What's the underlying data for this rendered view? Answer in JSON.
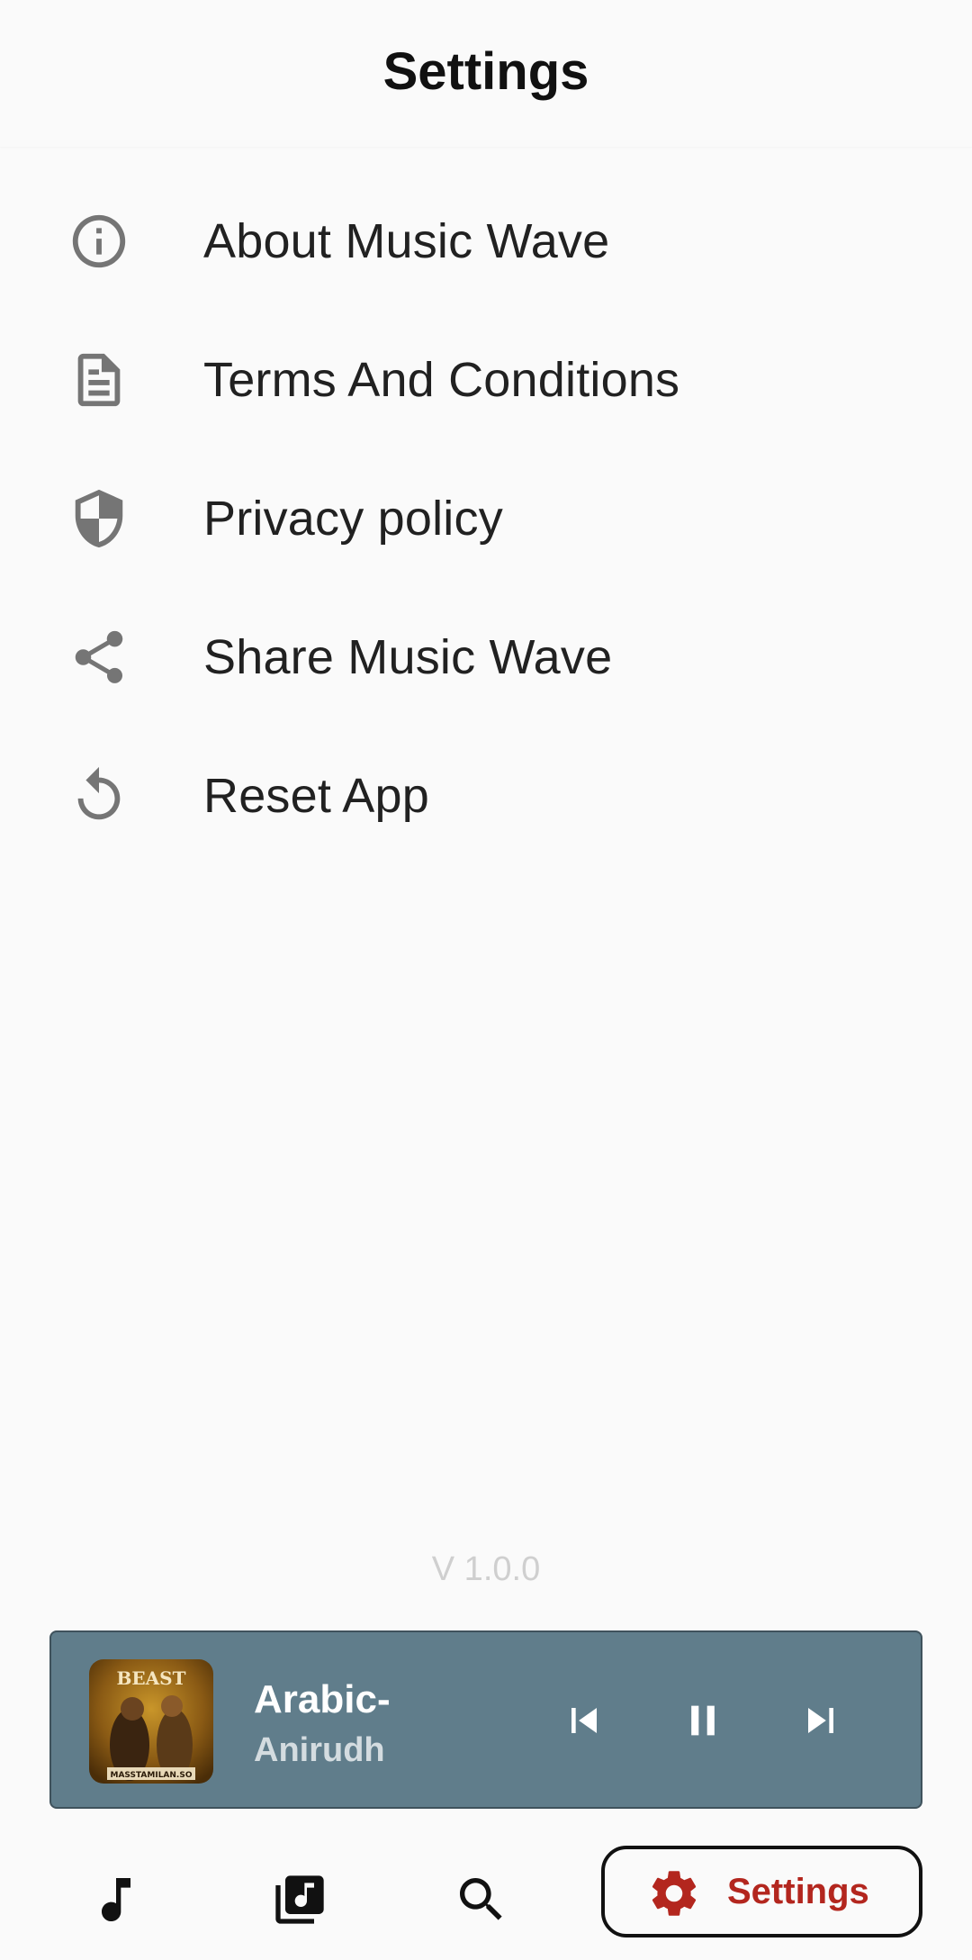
{
  "app_bar": {
    "title": "Settings"
  },
  "settings": {
    "items": [
      {
        "label": "About Music Wave",
        "icon": "info-icon"
      },
      {
        "label": "Terms And Conditions",
        "icon": "document-icon"
      },
      {
        "label": "Privacy policy",
        "icon": "shield-icon"
      },
      {
        "label": "Share Music Wave",
        "icon": "share-icon"
      },
      {
        "label": "Reset App",
        "icon": "reset-icon"
      }
    ]
  },
  "version": "V 1.0.0",
  "mini_player": {
    "title": "Arabic-",
    "artist": "Anirudh",
    "album_art": {
      "brand_text": "BEAST",
      "watermark": "MASSTAMILAN.SO"
    }
  },
  "bottom_nav": {
    "active_label": "Settings",
    "active_color": "#b3261e",
    "items": [
      "music-note-icon",
      "library-music-icon",
      "search-icon",
      "settings-gear-icon"
    ]
  },
  "colors": {
    "background": "#fafafa",
    "player_bg": "#607d8b",
    "icon_gray": "#757575"
  }
}
